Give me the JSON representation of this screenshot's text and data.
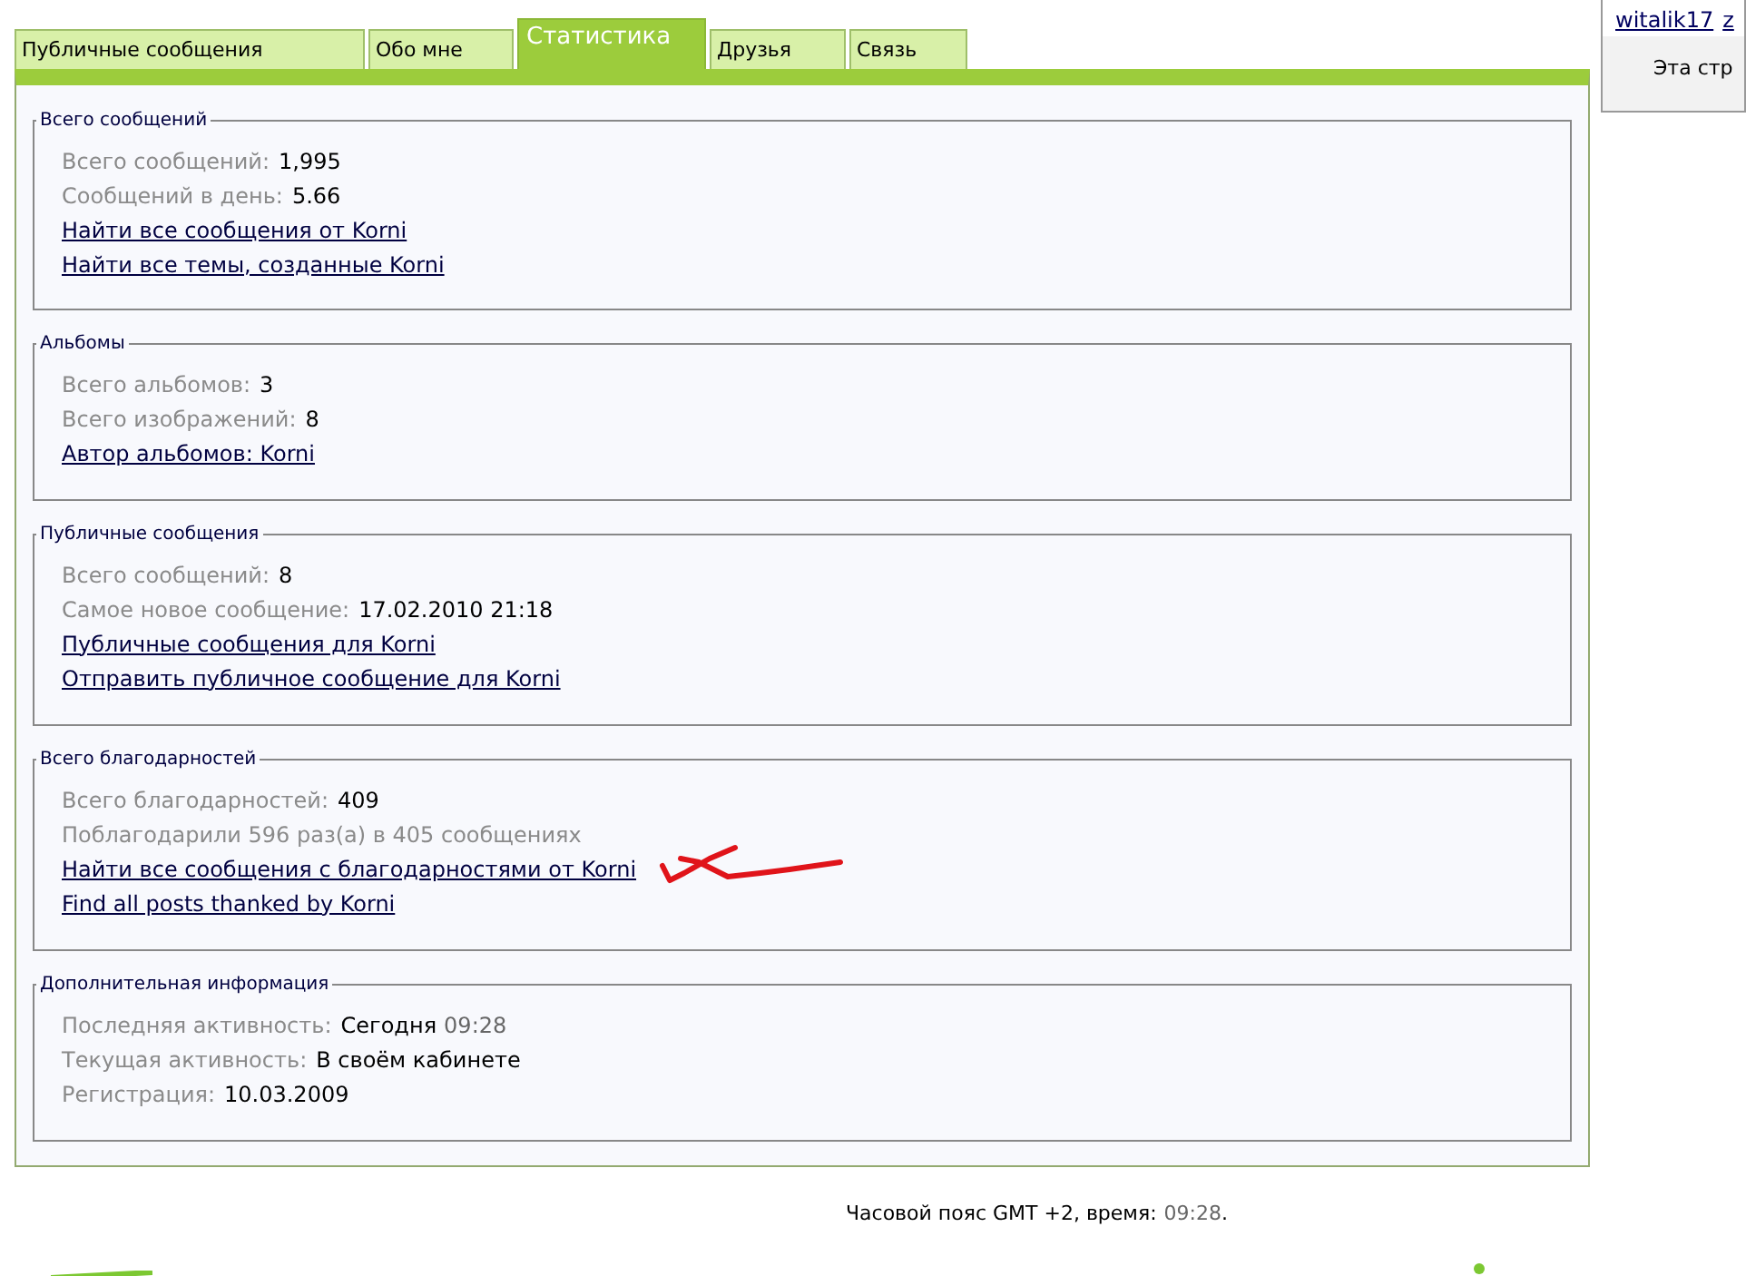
{
  "tabs": [
    {
      "label": "Публичные сообщения",
      "selected": false
    },
    {
      "label": "Обо мне",
      "selected": false
    },
    {
      "label": "Статистика",
      "selected": true
    },
    {
      "label": "Друзья",
      "selected": false
    },
    {
      "label": "Связь",
      "selected": false
    }
  ],
  "sections": [
    {
      "title": "Всего сообщений",
      "rows": [
        {
          "kind": "stat",
          "label": "Всего сообщений:",
          "value": "1,995"
        },
        {
          "kind": "stat",
          "label": "Сообщений в день:",
          "value": "5.66"
        },
        {
          "kind": "link",
          "text": "Найти все сообщения от Korni"
        },
        {
          "kind": "link",
          "text": "Найти все темы, созданные Korni"
        }
      ]
    },
    {
      "title": "Альбомы",
      "rows": [
        {
          "kind": "stat",
          "label": "Всего альбомов:",
          "value": "3"
        },
        {
          "kind": "stat",
          "label": "Всего изображений:",
          "value": "8"
        },
        {
          "kind": "link",
          "text": "Автор альбомов: Korni"
        }
      ]
    },
    {
      "title": "Публичные сообщения",
      "rows": [
        {
          "kind": "stat",
          "label": "Всего сообщений:",
          "value": "8"
        },
        {
          "kind": "stat",
          "label": "Самое новое сообщение:",
          "value": "17.02.2010 21:18"
        },
        {
          "kind": "link",
          "text": "Публичные сообщения для Korni"
        },
        {
          "kind": "link",
          "text": "Отправить публичное сообщение для Korni"
        }
      ]
    },
    {
      "title": "Всего благодарностей",
      "rows": [
        {
          "kind": "stat",
          "label": "Всего благодарностей:",
          "value": "409"
        },
        {
          "kind": "note",
          "text": "Поблагодарили 596 раз(а) в 405 сообщениях"
        },
        {
          "kind": "link",
          "text": "Найти все сообщения с благодарностями от Korni",
          "scribble": true
        },
        {
          "kind": "link",
          "text": "Find all posts thanked by Korni"
        }
      ]
    },
    {
      "title": "Дополнительная информация",
      "rows": [
        {
          "kind": "stat",
          "label": "Последняя активность:",
          "value": "Сегодня",
          "time": "09:28"
        },
        {
          "kind": "stat",
          "label": "Текущая активность:",
          "value": "В своём кабинете"
        },
        {
          "kind": "stat",
          "label": "Регистрация:",
          "value": "10.03.2009"
        }
      ]
    }
  ],
  "side_panel": {
    "users": [
      "witalik17",
      "z"
    ],
    "text": "Эта стр"
  },
  "footer": {
    "text": "Часовой пояс GMT +2, время:",
    "time": "09:28",
    "end": "."
  }
}
